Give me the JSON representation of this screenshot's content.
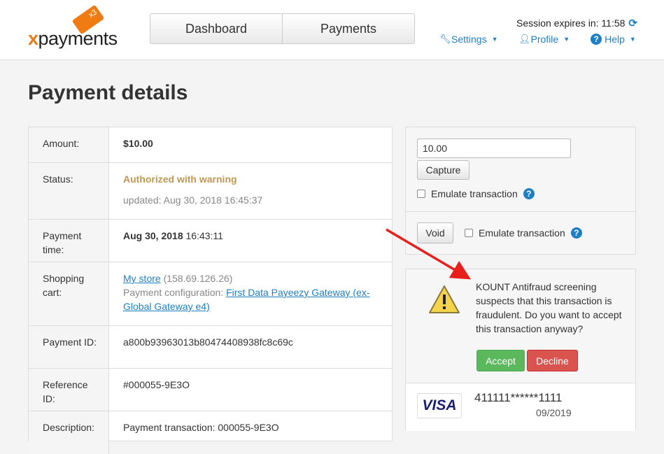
{
  "header": {
    "logo_prefix": "x",
    "logo_text": "payments",
    "logo_tag": "x3",
    "nav": [
      "Dashboard",
      "Payments"
    ],
    "session_label": "Session expires in: 11:58",
    "menu": {
      "settings": "Settings",
      "profile": "Profile",
      "help": "Help"
    }
  },
  "page_title": "Payment details",
  "details": {
    "amount_label": "Amount:",
    "amount_value": "$10.00",
    "status_label": "Status:",
    "status_value": "Authorized with warning",
    "status_updated": "updated: Aug 30, 2018 16:45:37",
    "payment_time_label": "Payment time:",
    "payment_time_date": "Aug 30, 2018",
    "payment_time_clock": "16:43:11",
    "cart_label": "Shopping cart:",
    "cart_store": "My store",
    "cart_ip": "(158.69.126.26)",
    "cart_config_label": "Payment configuration:",
    "cart_config_link": "First Data Payeezy Gateway (ex-Global Gateway e4)",
    "payment_id_label": "Payment ID:",
    "payment_id_value": "a800b93963013b80474408938fc8c69c",
    "reference_label": "Reference ID:",
    "reference_value": "#000055-9E3O",
    "description_label": "Description:",
    "description_value": "Payment transaction: 000055-9E3O"
  },
  "capture_panel": {
    "amount_input": "10.00",
    "capture_label": "Capture",
    "emulate_label": "Emulate transaction",
    "void_label": "Void",
    "emulate_label_2": "Emulate transaction"
  },
  "fraud_panel": {
    "message": "KOUNT Antifraud screening suspects that this transaction is fraudulent. Do you want to accept this transaction anyway?",
    "accept_label": "Accept",
    "decline_label": "Decline",
    "card_brand": "VISA",
    "card_number": "411111******1111",
    "card_expiry": "09/2019"
  },
  "colors": {
    "accent": "#1f7fc4",
    "warning_text": "#c09853",
    "accept": "#5cb85c",
    "decline": "#d9534f",
    "brand_orange": "#f07b13",
    "arrow": "#e8201c"
  }
}
